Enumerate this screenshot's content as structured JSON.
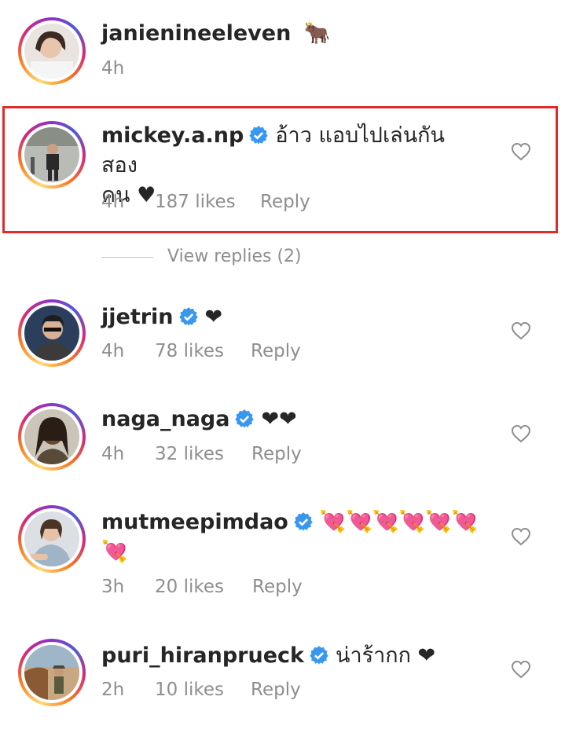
{
  "comments": [
    {
      "username": "janienineeleven",
      "text": "🐂",
      "time": "4h",
      "likes": "",
      "reply": "",
      "verified": false
    },
    {
      "username": "mickey.a.np",
      "text": "อ้าว แอบไปเล่นกันสอง",
      "text_line2": "คน ♥",
      "time": "4h",
      "likes": "187 likes",
      "reply": "Reply",
      "verified": true
    },
    {
      "username": "jjetrin",
      "text": "❤",
      "time": "4h",
      "likes": "78 likes",
      "reply": "Reply",
      "verified": true
    },
    {
      "username": "naga_naga",
      "text": "❤❤",
      "time": "4h",
      "likes": "32 likes",
      "reply": "Reply",
      "verified": true
    },
    {
      "username": "mutmeepimdao",
      "text": "💘💘💘💘💘💘💘",
      "time": "3h",
      "likes": "20 likes",
      "reply": "Reply",
      "verified": true
    },
    {
      "username": "puri_hiranprueck",
      "text": "น่าร้ากก ❤",
      "time": "2h",
      "likes": "10 likes",
      "reply": "Reply",
      "verified": true
    }
  ],
  "view_replies": "View replies (2)",
  "icons": {
    "like": "heart-outline-icon",
    "verified": "verified-badge-icon"
  },
  "colors": {
    "verified": "#3897f0",
    "highlight": "#e02b2b",
    "meta": "#8e8e8e"
  }
}
